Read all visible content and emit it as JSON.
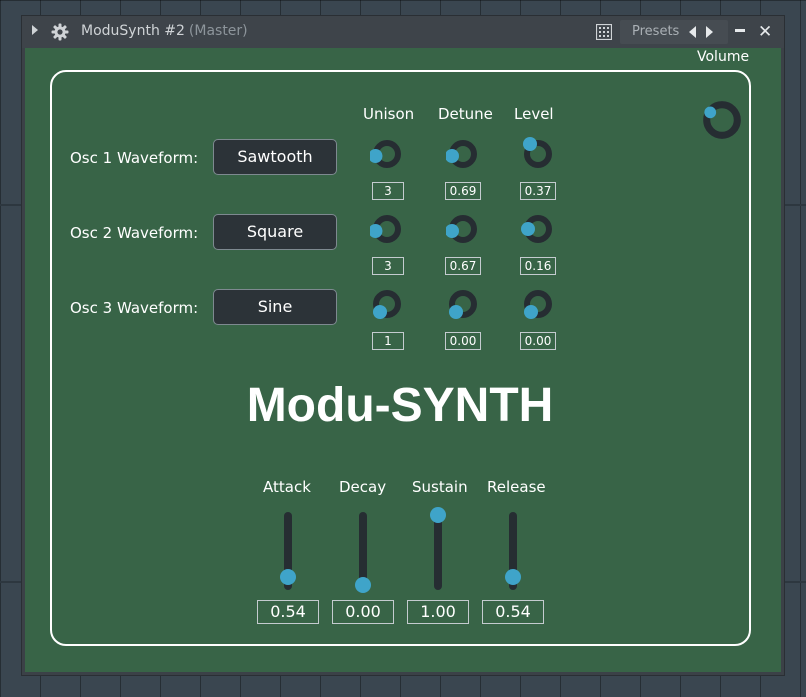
{
  "window": {
    "title": "ModuSynth #2",
    "subtitle": "(Master)",
    "presets_label": "Presets",
    "close_glyph": "✕"
  },
  "header": {
    "volume_label": "Volume",
    "columns": [
      "Unison",
      "Detune",
      "Level"
    ]
  },
  "oscillators": [
    {
      "label": "Osc 1 Waveform:",
      "waveform": "Sawtooth",
      "unison": "3",
      "detune": "0.69",
      "level": "0.37"
    },
    {
      "label": "Osc 2 Waveform:",
      "waveform": "Square",
      "unison": "3",
      "detune": "0.67",
      "level": "0.16"
    },
    {
      "label": "Osc 3 Waveform:",
      "waveform": "Sine",
      "unison": "1",
      "detune": "0.00",
      "level": "0.00"
    }
  ],
  "logo": "Modu-SYNTH",
  "envelope": [
    {
      "label": "Attack",
      "value": "0.54"
    },
    {
      "label": "Decay",
      "value": "0.00"
    },
    {
      "label": "Sustain",
      "value": "1.00"
    },
    {
      "label": "Release",
      "value": "0.54"
    }
  ],
  "colors": {
    "panel_bg": "#386447",
    "accent": "#3fa4c9",
    "knob_track": "#262d32",
    "outline": "#ffffff"
  },
  "icons": {
    "title_arrow": "play-triangle-icon",
    "settings": "gear-icon",
    "grid": "grid-icon",
    "prev": "chevron-left-icon",
    "next": "chevron-right-icon",
    "minimize": "minimize-icon",
    "close": "close-icon"
  }
}
